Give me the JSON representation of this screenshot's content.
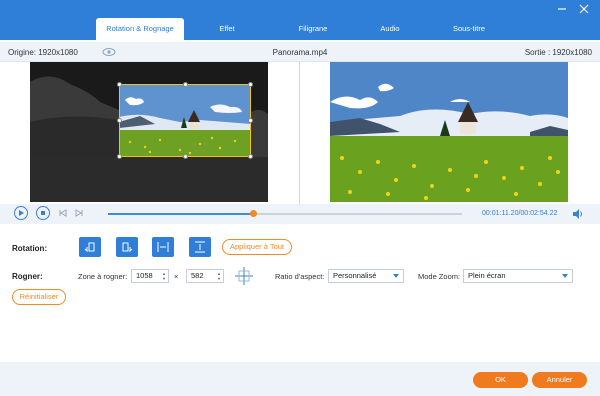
{
  "window": {
    "minimize_icon": "minus",
    "close_icon": "x"
  },
  "tabs": [
    {
      "label": "Rotation & Rognage",
      "active": true
    },
    {
      "label": "Effet",
      "active": false
    },
    {
      "label": "Filigrane",
      "active": false
    },
    {
      "label": "Audio",
      "active": false
    },
    {
      "label": "Sous-titre",
      "active": false
    }
  ],
  "infobar": {
    "origin": "Origine: 1920x1080",
    "filename": "Panorama.mp4",
    "output": "Sortie : 1920x1080"
  },
  "player": {
    "progress": 0.41,
    "time": "00:01:11.20/00:02:54.22"
  },
  "rotation": {
    "label": "Rotation:",
    "buttons": [
      "rotate-left",
      "rotate-right",
      "flip-horizontal",
      "flip-vertical"
    ],
    "apply_all": "Appliquer à Tout"
  },
  "crop": {
    "label": "Rogner:",
    "zone_label": "Zone à rogner:",
    "width": "1058",
    "times": "×",
    "height": "582",
    "aspect_label": "Ratio d'aspect:",
    "aspect_value": "Personnalisé",
    "zoom_label": "Mode Zoom:",
    "zoom_value": "Plein écran",
    "reset": "Réinitialiser"
  },
  "footer": {
    "ok": "OK",
    "cancel": "Annuler"
  },
  "colors": {
    "accent": "#2f7ed8",
    "orange": "#f07a1e"
  }
}
